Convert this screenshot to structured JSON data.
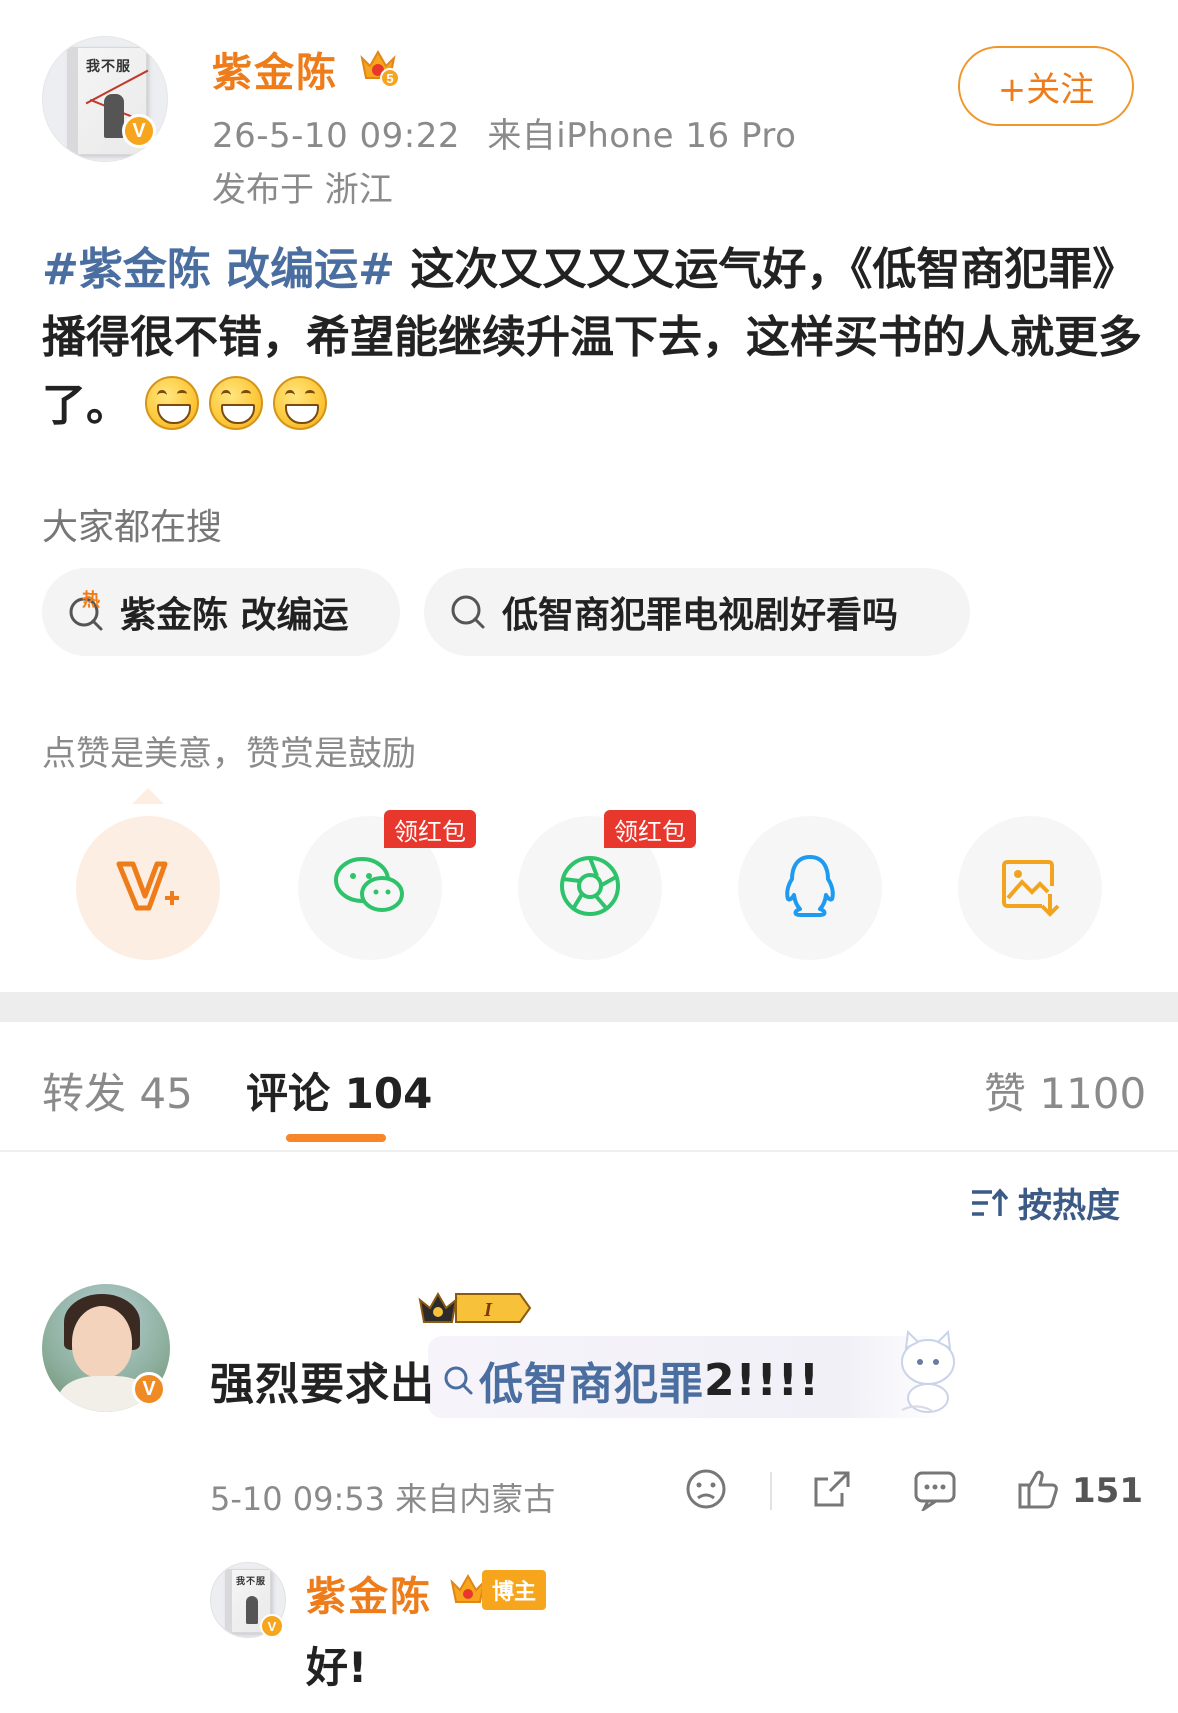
{
  "post": {
    "author": "紫金陈",
    "timestamp": "26-5-10 09:22",
    "source": "来自iPhone 16 Pro",
    "location": "发布于 浙江",
    "follow_label": "+关注",
    "body_hashtag": "#紫金陈 改编运#",
    "body_text": " 这次又又又又运气好，《低智商犯罪》播得很不错，希望能继续升温下去，这样买书的人就更多了。",
    "book_title": "我不服",
    "level_badge": "5"
  },
  "search": {
    "title": "大家都在搜",
    "hot_tag": "热",
    "chips": [
      {
        "label": "紫金陈 改编运"
      },
      {
        "label": "低智商犯罪电视剧好看吗"
      }
    ]
  },
  "reward": {
    "hint": "点赞是美意，赞赏是鼓励",
    "redpack_label": "领红包"
  },
  "tabs": {
    "repost": "转发 45",
    "comments": "评论 104",
    "likes": "赞 1100"
  },
  "sort": {
    "label": "按热度"
  },
  "comment": {
    "text_prefix": "强烈要求出",
    "link_text": "低智商犯罪",
    "text_suffix": "2!!!!",
    "badge_level": "I",
    "meta": "5-10 09:53 来自内蒙古",
    "like_count": "151"
  },
  "reply": {
    "author": "紫金陈",
    "badge_label": "博主",
    "text": "好!"
  },
  "colors": {
    "accent": "#ef7c1a",
    "link": "#4a6ea0",
    "muted": "#8a8a8a"
  }
}
